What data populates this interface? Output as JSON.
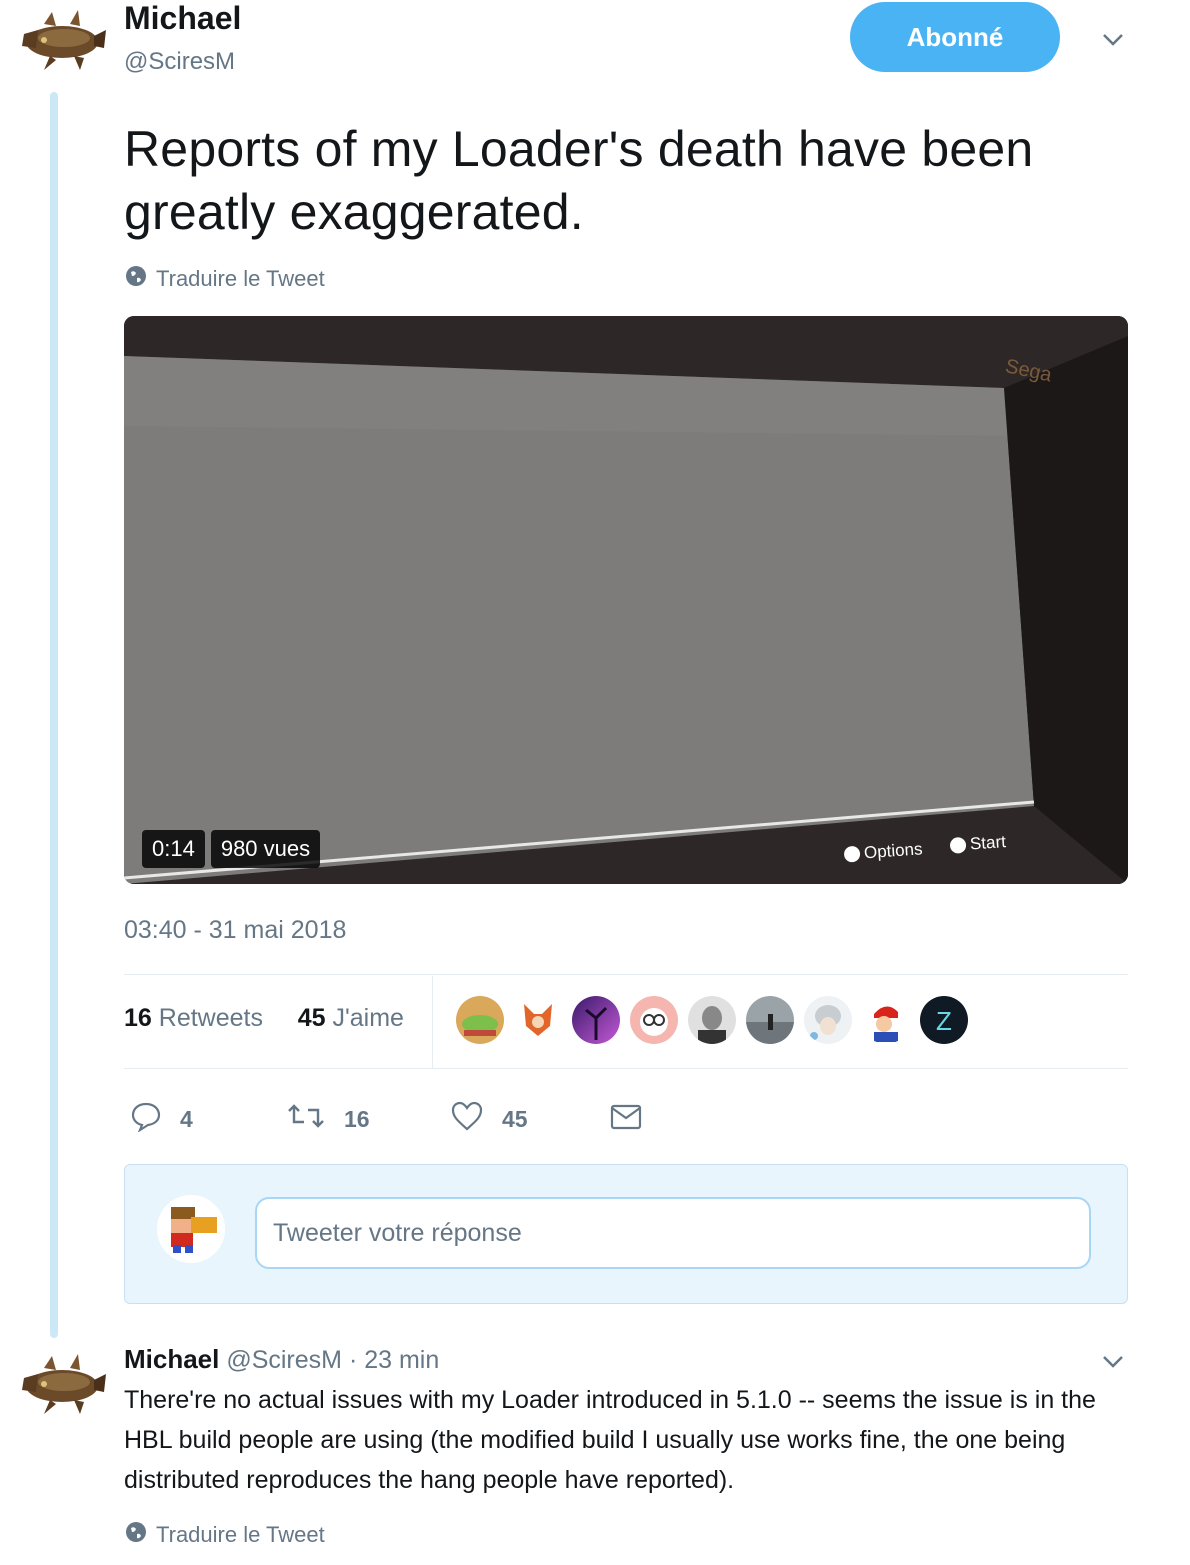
{
  "tweet": {
    "author": {
      "name": "Michael",
      "handle": "@SciresM"
    },
    "follow_label": "Abonné",
    "text": "Reports of my Loader's death have been greatly exaggerated.",
    "translate_label": "Traduire le Tweet",
    "video": {
      "duration": "0:14",
      "views": "980 vues",
      "overlay_options": "Options",
      "overlay_start": "Start"
    },
    "timestamp": "03:40 - 31 mai 2018",
    "stats": {
      "retweets_count": "16",
      "retweets_label": "Retweets",
      "likes_count": "45",
      "likes_label": "J'aime"
    },
    "likers": [
      "liker-1",
      "liker-2",
      "liker-3",
      "liker-4",
      "liker-5",
      "liker-6",
      "liker-7",
      "liker-8",
      "liker-9"
    ],
    "actions": {
      "replies": "4",
      "retweets": "16",
      "likes": "45"
    }
  },
  "reply_box": {
    "placeholder": "Tweeter votre réponse"
  },
  "reply": {
    "author": {
      "name": "Michael",
      "handle": "@SciresM"
    },
    "time": "· 23 min",
    "text": "There're no actual issues with my Loader introduced in 5.1.0 -- seems the issue is in the HBL build people are using (the modified build I usually use works fine, the one being distributed reproduces the hang people have reported).",
    "translate_label": "Traduire le Tweet"
  },
  "colors": {
    "accent": "#4ab3f4",
    "muted": "#657786",
    "thread_line": "#cce8f7",
    "reply_bg": "#e8f5fd"
  }
}
